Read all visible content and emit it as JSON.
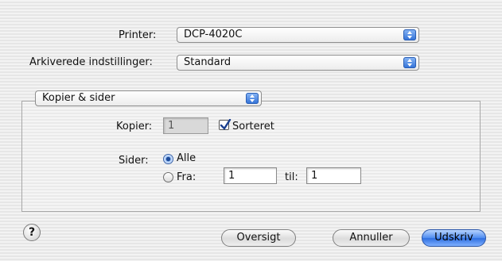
{
  "printer": {
    "label": "Printer:",
    "value": "DCP-4020C"
  },
  "presets": {
    "label": "Arkiverede indstillinger:",
    "value": "Standard"
  },
  "panel_selector": {
    "value": "Kopier & sider"
  },
  "copies": {
    "label": "Kopier:",
    "value": "1",
    "collate_label": "Sorteret",
    "collate_checked": true
  },
  "pages": {
    "label": "Sider:",
    "all_label": "Alle",
    "from_label": "Fra:",
    "from_value": "1",
    "to_label": "til:",
    "to_value": "1",
    "selected": "all"
  },
  "buttons": {
    "help": "?",
    "preview": "Oversigt",
    "cancel": "Annuller",
    "print": "Udskriv"
  },
  "colors": {
    "accent": "#2f6fe0"
  }
}
